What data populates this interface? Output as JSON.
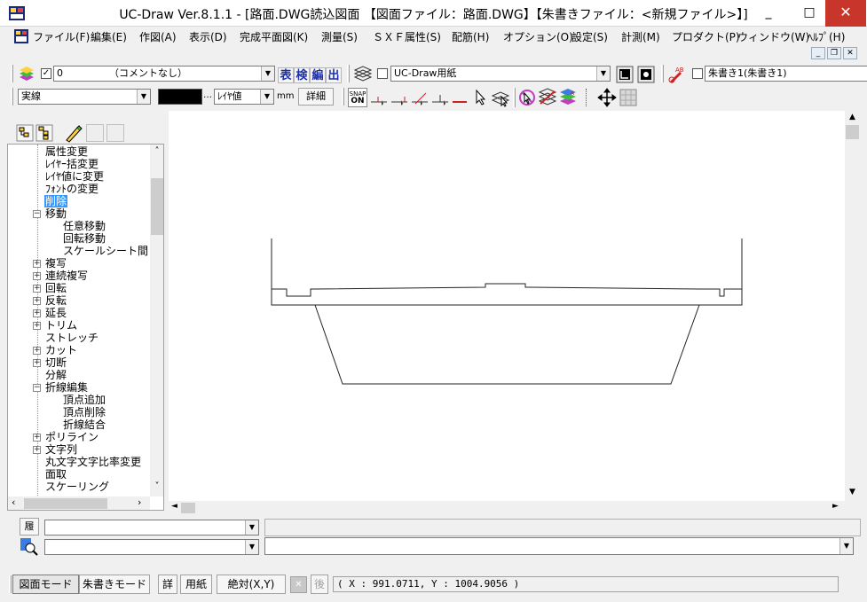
{
  "window": {
    "title": "UC-Draw Ver.8.1.1 - [路面.DWG読込図面 【図面ファイル：路面.DWG】【朱書きファイル：<新規ファイル>】]",
    "minimize": "_",
    "maximize": "□",
    "close": "✕"
  },
  "menu": {
    "items": [
      "ファイル(F)",
      "編集(E)",
      "作図(A)",
      "表示(D)",
      "完成平面図(K)",
      "測量(S)",
      "ＳＸＦ属性(S)",
      "配筋(H)",
      "オプション(O)",
      "設定(S)",
      "計測(M)",
      "プロダクト(P)",
      "ウィンドウ(W)",
      "ﾍﾙﾌﾟ(H)"
    ]
  },
  "toolbar1": {
    "layer_value": "0",
    "layer_comment": "（コメントなし）",
    "btn_table": "表",
    "btn_inspect": "検",
    "btn_edit": "編",
    "btn_out": "出",
    "paper_value": "UC-Draw用紙",
    "redline_value": "朱書き1(朱書き1)"
  },
  "toolbar2": {
    "linetype_value": "実線",
    "width_value": "ﾚｲﾔ値",
    "unit": "mm",
    "detail_button": "詳細",
    "snap_label_top": "SNAP",
    "snap_label_bottom": "ON"
  },
  "tree": {
    "items": [
      {
        "label": "属性変更",
        "expander": ""
      },
      {
        "label": "ﾚｲﾔｰ括変更",
        "expander": ""
      },
      {
        "label": "ﾚｲﾔ値に変更",
        "expander": ""
      },
      {
        "label": "ﾌｫﾝﾄの変更",
        "expander": ""
      },
      {
        "label": "削除",
        "expander": "",
        "selected": true
      },
      {
        "label": "移動",
        "expander": "−"
      },
      {
        "label": "任意移動",
        "expander": "",
        "child": true
      },
      {
        "label": "回転移動",
        "expander": "",
        "child": true
      },
      {
        "label": "スケールシート間",
        "expander": "",
        "child": true
      },
      {
        "label": "複写",
        "expander": "+"
      },
      {
        "label": "連続複写",
        "expander": "+"
      },
      {
        "label": "回転",
        "expander": "+"
      },
      {
        "label": "反転",
        "expander": "+"
      },
      {
        "label": "延長",
        "expander": "+"
      },
      {
        "label": "トリム",
        "expander": "+"
      },
      {
        "label": "ストレッチ",
        "expander": ""
      },
      {
        "label": "カット",
        "expander": "+"
      },
      {
        "label": "切断",
        "expander": "+"
      },
      {
        "label": "分解",
        "expander": ""
      },
      {
        "label": "折線編集",
        "expander": "−"
      },
      {
        "label": "頂点追加",
        "expander": "",
        "child": true
      },
      {
        "label": "頂点削除",
        "expander": "",
        "child": true
      },
      {
        "label": "折線結合",
        "expander": "",
        "child": true
      },
      {
        "label": "ポリライン",
        "expander": "+"
      },
      {
        "label": "文字列",
        "expander": "+"
      },
      {
        "label": "丸文字文字比率変更",
        "expander": ""
      },
      {
        "label": "面取",
        "expander": ""
      },
      {
        "label": "スケーリング",
        "expander": ""
      }
    ]
  },
  "bottom": {
    "history_label": "履"
  },
  "statusbar": {
    "drawing_mode": "図面モード",
    "redline_mode": "朱書きモード",
    "detail": "詳",
    "paper": "用紙",
    "absolute": "絶対(X,Y)",
    "back": "後",
    "coords": "( X : 991.0711, Y : 1004.9056 )"
  }
}
